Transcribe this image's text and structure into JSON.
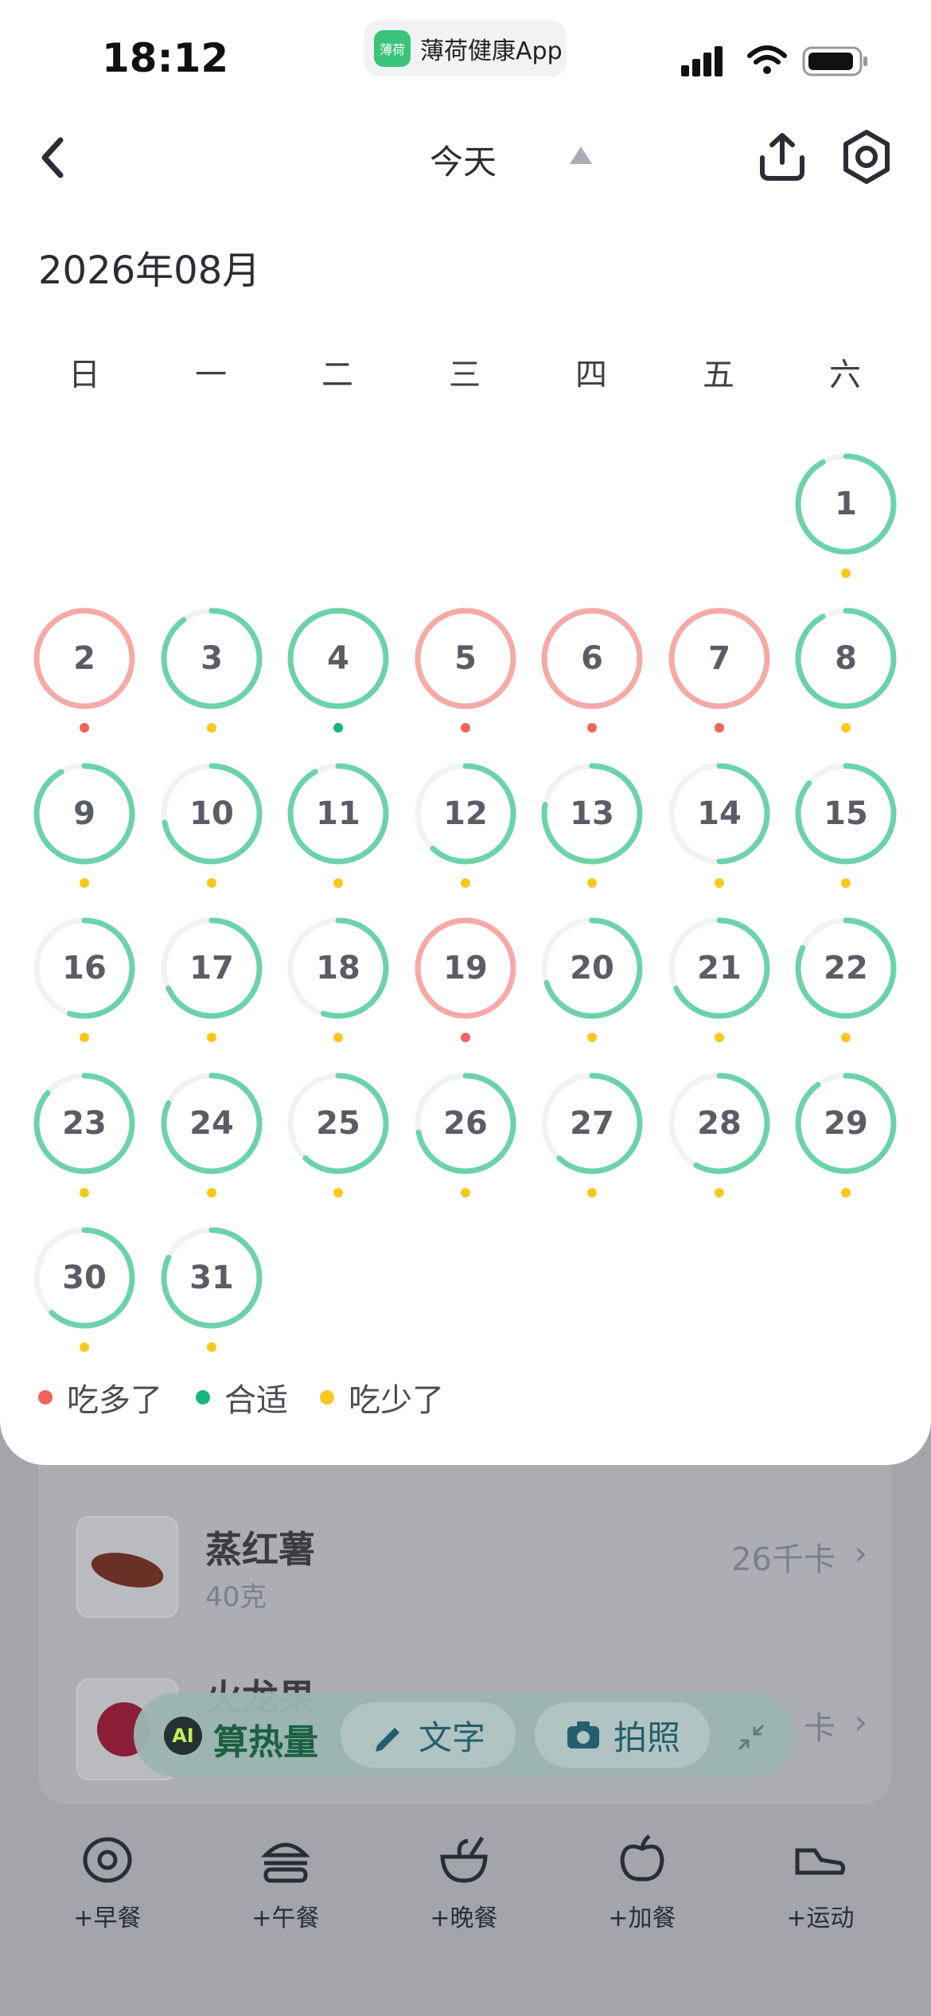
{
  "status_bar": {
    "time": "18:12",
    "app_badge_logo_text": "薄荷",
    "app_name": "薄荷健康App"
  },
  "header": {
    "title": "今天"
  },
  "calendar": {
    "month_title": "2026年08月",
    "weekdays": [
      "日",
      "一",
      "二",
      "三",
      "四",
      "五",
      "六"
    ],
    "first_weekday_index": 6,
    "days": [
      {
        "day": "1",
        "ring": "green",
        "progress": 0.92,
        "dot": "yellow"
      },
      {
        "day": "2",
        "ring": "red",
        "progress": 1,
        "dot": "red"
      },
      {
        "day": "3",
        "ring": "green",
        "progress": 0.9,
        "dot": "yellow"
      },
      {
        "day": "4",
        "ring": "green",
        "progress": 1,
        "dot": "green"
      },
      {
        "day": "5",
        "ring": "red",
        "progress": 1,
        "dot": "red"
      },
      {
        "day": "6",
        "ring": "red",
        "progress": 1,
        "dot": "red"
      },
      {
        "day": "7",
        "ring": "red",
        "progress": 1,
        "dot": "red"
      },
      {
        "day": "8",
        "ring": "green",
        "progress": 0.92,
        "dot": "yellow"
      },
      {
        "day": "9",
        "ring": "green",
        "progress": 0.92,
        "dot": "yellow"
      },
      {
        "day": "10",
        "ring": "green",
        "progress": 0.72,
        "dot": "yellow"
      },
      {
        "day": "11",
        "ring": "green",
        "progress": 0.92,
        "dot": "yellow"
      },
      {
        "day": "12",
        "ring": "green",
        "progress": 0.62,
        "dot": "yellow"
      },
      {
        "day": "13",
        "ring": "green",
        "progress": 0.78,
        "dot": "yellow"
      },
      {
        "day": "14",
        "ring": "green",
        "progress": 0.5,
        "dot": "yellow"
      },
      {
        "day": "15",
        "ring": "green",
        "progress": 0.86,
        "dot": "yellow"
      },
      {
        "day": "16",
        "ring": "green",
        "progress": 0.55,
        "dot": "yellow"
      },
      {
        "day": "17",
        "ring": "green",
        "progress": 0.68,
        "dot": "yellow"
      },
      {
        "day": "18",
        "ring": "green",
        "progress": 0.55,
        "dot": "yellow"
      },
      {
        "day": "19",
        "ring": "red",
        "progress": 1,
        "dot": "red"
      },
      {
        "day": "20",
        "ring": "green",
        "progress": 0.7,
        "dot": "yellow"
      },
      {
        "day": "21",
        "ring": "green",
        "progress": 0.68,
        "dot": "yellow"
      },
      {
        "day": "22",
        "ring": "green",
        "progress": 0.82,
        "dot": "yellow"
      },
      {
        "day": "23",
        "ring": "green",
        "progress": 0.86,
        "dot": "yellow"
      },
      {
        "day": "24",
        "ring": "green",
        "progress": 0.82,
        "dot": "yellow"
      },
      {
        "day": "25",
        "ring": "green",
        "progress": 0.62,
        "dot": "yellow"
      },
      {
        "day": "26",
        "ring": "green",
        "progress": 0.72,
        "dot": "yellow"
      },
      {
        "day": "27",
        "ring": "green",
        "progress": 0.62,
        "dot": "yellow"
      },
      {
        "day": "28",
        "ring": "green",
        "progress": 0.58,
        "dot": "yellow"
      },
      {
        "day": "29",
        "ring": "green",
        "progress": 0.9,
        "dot": "yellow"
      },
      {
        "day": "30",
        "ring": "green",
        "progress": 0.62,
        "dot": "yellow"
      },
      {
        "day": "31",
        "ring": "green",
        "progress": 0.82,
        "dot": "yellow"
      }
    ]
  },
  "legend": [
    {
      "label": "吃多了",
      "color": "#f0645c"
    },
    {
      "label": "合适",
      "color": "#17b77b"
    },
    {
      "label": "吃少了",
      "color": "#f8c91d"
    }
  ],
  "colors": {
    "ring_green": "#6cd3a8",
    "ring_red": "#f5aaa8",
    "ring_track": "#f1f2f4",
    "dot_red": "#f0645c",
    "dot_green": "#17b77b",
    "dot_yellow": "#f8c91d"
  },
  "food_list": [
    {
      "name": "蒸红薯",
      "amount": "40克",
      "calories": "26千卡"
    },
    {
      "name": "火龙果",
      "amount": "",
      "calories": "卡"
    }
  ],
  "ai_bar": {
    "ai_label": "算热量",
    "text_label": "文字",
    "photo_label": "拍照"
  },
  "bottom_nav": [
    {
      "label": "+早餐",
      "icon": "egg-icon"
    },
    {
      "label": "+午餐",
      "icon": "burger-icon"
    },
    {
      "label": "+晚餐",
      "icon": "bowl-icon"
    },
    {
      "label": "+加餐",
      "icon": "apple-icon"
    },
    {
      "label": "+运动",
      "icon": "sneaker-icon"
    }
  ]
}
